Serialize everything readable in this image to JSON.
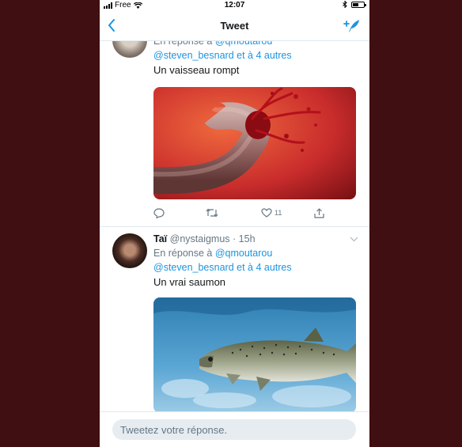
{
  "status_bar": {
    "carrier": "Free",
    "time": "12:07"
  },
  "navbar": {
    "title": "Tweet",
    "back_icon": "chevron-left-icon",
    "compose_icon": "compose-tweet-icon"
  },
  "tweets": [
    {
      "replying_prefix": "En réponse à",
      "replying_user": "@qmoutarou",
      "replying_line2_user": "@steven_besnard",
      "replying_line2_rest": "et à 4 autres",
      "text": "Un vaisseau rompt",
      "media_alt": "Illustration d'un vaisseau sanguin qui éclate",
      "likes": "11"
    },
    {
      "name": "Taï",
      "handle": "@nystaigmus",
      "time": "· 15h",
      "replying_prefix": "En réponse à",
      "replying_user": "@qmoutarou",
      "replying_line2_user": "@steven_besnard",
      "replying_line2_rest": "et à 4 autres",
      "text": "Un vrai saumon",
      "media_alt": "Photo d'un saumon sous l'eau"
    }
  ],
  "reply": {
    "placeholder": "Tweetez votre réponse."
  },
  "colors": {
    "background": "#3f0f12",
    "accent": "#1b95e0",
    "muted": "#657786"
  }
}
